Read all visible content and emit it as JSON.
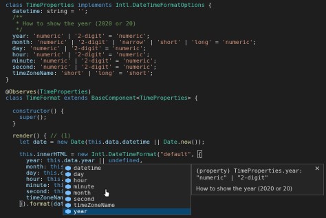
{
  "code": {
    "l1": {
      "a": "class ",
      "b": "TimeProperties",
      "c": " implements ",
      "d": "Intl.DateTimeFormatOptions",
      "e": " {"
    },
    "l2": {
      "a": "  datetime",
      "b": ": string = ",
      "c": "''",
      "d": ";"
    },
    "l3": "  /**",
    "l4": "   * How to show the year (2020 or 20)",
    "l5": "   */",
    "l6": {
      "a": "  year",
      "b": ": ",
      "c": "'numeric'",
      "d": " | ",
      "e": "'2-digit'",
      "f": " = ",
      "g": "'numeric'",
      "h": ";"
    },
    "l7": {
      "a": "  month",
      "b": ": ",
      "c": "'numeric'",
      "d": " | ",
      "e": "'2-digit'",
      "f": " | ",
      "g": "'narrow'",
      "h": " | ",
      "i": "'short'",
      "j": " | ",
      "k": "'long'",
      "l": " = ",
      "m": "'numeric'",
      "n": ";"
    },
    "l8": {
      "a": "  day",
      "b": ": ",
      "c": "'numeric'",
      "d": " | ",
      "e": "'2-digit'",
      "f": " = ",
      "g": "'numeric'",
      "h": ";"
    },
    "l9": {
      "a": "  hour",
      "b": ": ",
      "c": "'numeric'",
      "d": " | ",
      "e": "'2-digit'",
      "f": " = ",
      "g": "'numeric'",
      "h": ";"
    },
    "l10": {
      "a": "  minute",
      "b": ": ",
      "c": "'numeric'",
      "d": " | ",
      "e": "'2-digit'",
      "f": " = ",
      "g": "'numeric'",
      "h": ";"
    },
    "l11": {
      "a": "  second",
      "b": ": ",
      "c": "'numeric'",
      "d": " | ",
      "e": "'2-digit'",
      "f": " = ",
      "g": "'numeric'",
      "h": ";"
    },
    "l12": {
      "a": "  timeZoneName",
      "b": ": ",
      "c": "'short'",
      "d": " | ",
      "e": "'long'",
      "f": " = ",
      "g": "'short'",
      "h": ";"
    },
    "l13": "}",
    "l15": {
      "a": "@",
      "b": "Observes",
      "c": "(",
      "d": "TimeProperties",
      "e": ")"
    },
    "l16": {
      "a": "class ",
      "b": "TimeFormat",
      "c": " extends ",
      "d": "BaseComponent",
      "e": "<",
      "f": "TimeProperties",
      "g": "> {"
    },
    "l18": {
      "a": "  ",
      "b": "constructor",
      "c": "() {"
    },
    "l19": {
      "a": "    ",
      "b": "super",
      "c": "();"
    },
    "l20": "  }",
    "l22": {
      "a": "  ",
      "b": "render",
      "c": "() { ",
      "d": "// (1)"
    },
    "l23": {
      "a": "    ",
      "b": "let ",
      "c": "date",
      "d": " = ",
      "e": "new ",
      "f": "Date",
      "g": "(",
      "h": "this",
      "i": ".",
      "j": "data",
      "k": ".",
      "l": "datetime",
      "m": " || ",
      "n": "Date",
      "o": ".",
      "p": "now",
      "q": "());"
    },
    "l25": {
      "a": "    ",
      "b": "this",
      "c": ".",
      "d": "innerHTML",
      "e": " = ",
      "f": "new ",
      "g": "Intl",
      "h": ".",
      "i": "DateTimeFormat",
      "j": "(",
      "k": "\"default\"",
      "l": ", ",
      "m": "{"
    },
    "l26": {
      "a": "      ",
      "b": "year",
      "c": ": ",
      "d": "this",
      "e": ".",
      "f": "data",
      "g": ".",
      "h": "year",
      "i": " || ",
      "j": "undefined",
      "k": ","
    },
    "l27": {
      "a": "      ",
      "b": "month",
      "c": ": ",
      "d": "this",
      "e": "."
    },
    "l28": {
      "a": "      ",
      "b": "day",
      "c": ": ",
      "d": "this",
      "e": ".",
      "f": "data",
      "g": "."
    },
    "l29": {
      "a": "      ",
      "b": "hour",
      "c": ": ",
      "d": "this",
      "e": ".",
      "f": "data",
      "g": "."
    },
    "l30": {
      "a": "      ",
      "b": "minute",
      "c": ": ",
      "d": "this",
      "e": ".",
      "f": "d"
    },
    "l31": {
      "a": "      ",
      "b": "second",
      "c": ": ",
      "d": "this",
      "e": "."
    },
    "l32": {
      "a": "      ",
      "b": "timeZoneName",
      "c": ": ",
      "d": "th"
    },
    "l33": {
      "a": "    ",
      "b": "}",
      "c": ").",
      "d": "format",
      "e": "(",
      "f": "date",
      "g": ");"
    }
  },
  "suggest": {
    "items": [
      "datetime",
      "day",
      "hour",
      "minute",
      "month",
      "second",
      "timeZoneName",
      "year"
    ],
    "selected_index": 7,
    "icon": "property-icon"
  },
  "details": {
    "signature": "(property) TimeProperties.year: \"numeric\" | \"2-digit\"",
    "doc": "How to show the year (2020 or 20)",
    "close_icon": "close-icon"
  },
  "colors": {
    "background": "#1e1e1e",
    "keyword": "#569cd6",
    "type": "#4ec9b0",
    "property": "#9cdcfe",
    "string": "#ce9178",
    "comment": "#6a9955",
    "function": "#dcdcaa",
    "selection": "#094771"
  }
}
